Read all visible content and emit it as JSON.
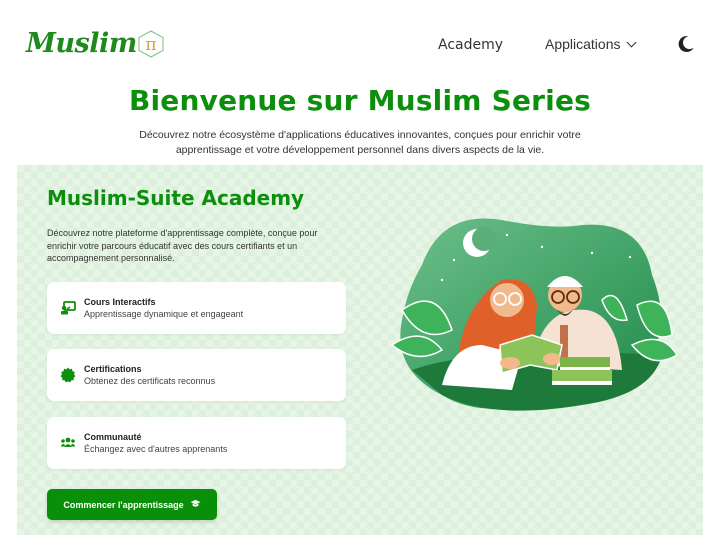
{
  "header": {
    "logo_text": "Muslim",
    "logo_symbol": "π",
    "nav": {
      "academy_label": "Academy",
      "applications_label": "Applications"
    },
    "theme_toggle_icon": "moon-icon"
  },
  "hero": {
    "title": "Bienvenue sur Muslim Series",
    "subtitle": "Découvrez notre écosystème d'applications éducatives innovantes, conçues pour enrichir votre apprentissage et votre développement personnel dans divers aspects de la vie."
  },
  "academy": {
    "title": "Muslim-Suite Academy",
    "description": "Découvrez notre plateforme d'apprentissage complète, conçue pour enrichir votre parcours éducatif avec des cours certifiants et un accompagnement personnalisé.",
    "features": [
      {
        "icon": "chalkboard-teacher-icon",
        "title": "Cours Interactifs",
        "description": "Apprentissage dynamique et engageant"
      },
      {
        "icon": "certificate-icon",
        "title": "Certifications",
        "description": "Obtenez des certificats reconnus"
      },
      {
        "icon": "users-icon",
        "title": "Communauté",
        "description": "Échangez avec d'autres apprenants"
      }
    ],
    "cta_label": "Commencer l'apprentissage",
    "cta_icon": "graduation-cap-icon",
    "illustration": "couple-reading-book-illustration"
  },
  "colors": {
    "brand_green": "#0c8f0c",
    "button_green": "#0a8f0a",
    "panel_bg": "#e6f5e6",
    "logo_accent": "#d9a23a"
  }
}
